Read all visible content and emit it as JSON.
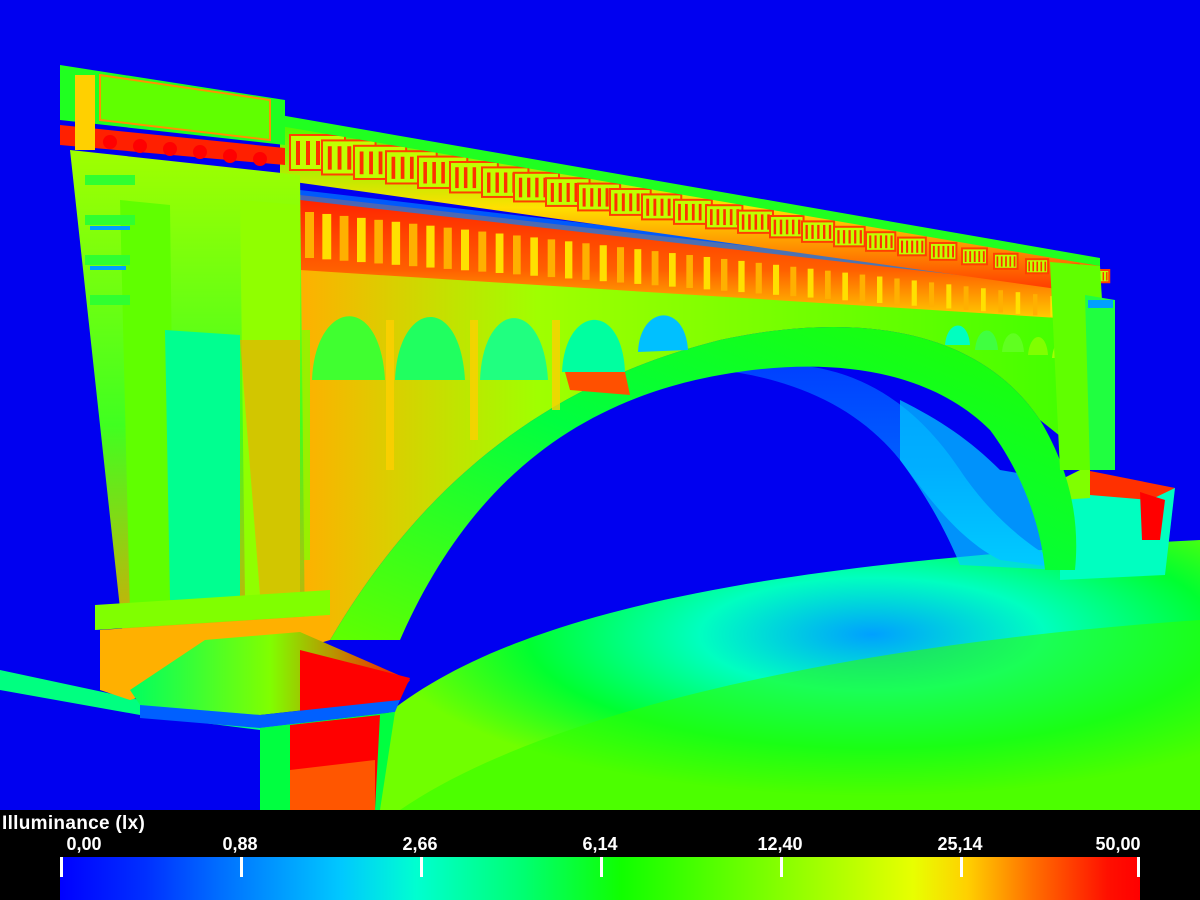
{
  "legend": {
    "title": "Illuminance (lx)",
    "ticks": [
      "0,00",
      "0,88",
      "2,66",
      "6,14",
      "12,40",
      "25,14",
      "50,00"
    ],
    "colors": {
      "min": "#0000ff",
      "low": "#00c8ff",
      "mid": "#10ff00",
      "high": "#e8ff00",
      "max": "#ff0000"
    }
  },
  "scene": {
    "subject": "bridge-icon",
    "background_color": "#0000f0"
  }
}
